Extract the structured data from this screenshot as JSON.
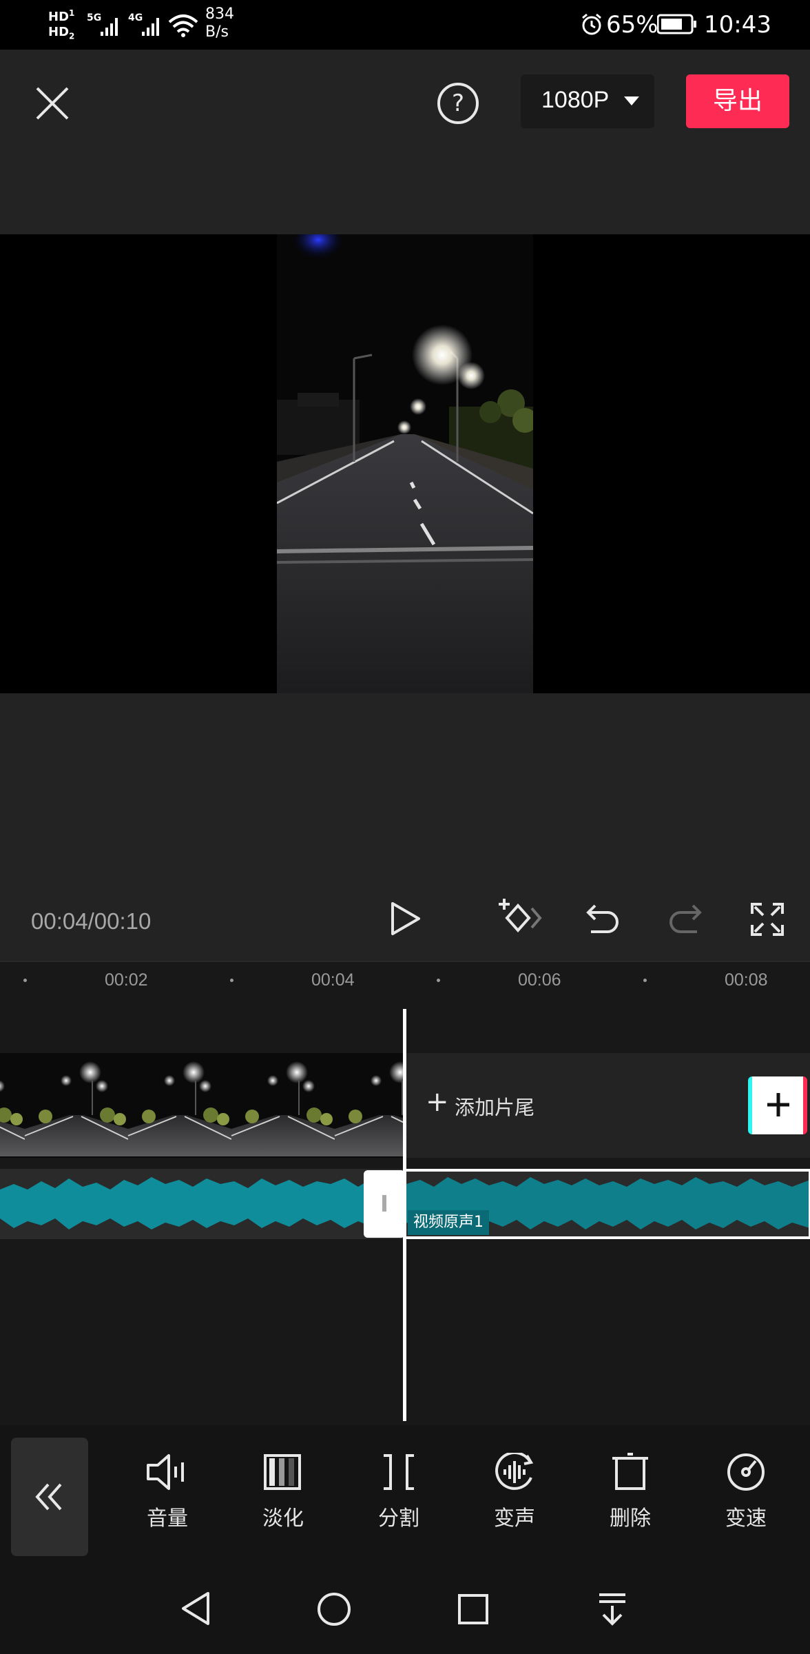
{
  "status_bar": {
    "network_left": "HD",
    "net_speed_value": "834",
    "net_speed_unit": "B/s",
    "battery": "65%",
    "time": "10:43"
  },
  "toolbar": {
    "resolution": "1080P",
    "export_label": "导出"
  },
  "player": {
    "time_readout": "00:04/00:10"
  },
  "timeline": {
    "ticks": [
      "00:02",
      "00:04",
      "00:06",
      "00:08"
    ],
    "add_ending_label": "添加片尾",
    "audio_label": "视频原声1"
  },
  "tools": [
    {
      "label": "音量",
      "icon": "volume-icon"
    },
    {
      "label": "淡化",
      "icon": "fade-icon"
    },
    {
      "label": "分割",
      "icon": "split-icon"
    },
    {
      "label": "变声",
      "icon": "voice-change-icon"
    },
    {
      "label": "删除",
      "icon": "delete-icon"
    },
    {
      "label": "变速",
      "icon": "speed-icon"
    }
  ],
  "colors": {
    "accent": "#fe2c55",
    "audio_wave": "#0f8d9a",
    "panel": "#232323"
  }
}
